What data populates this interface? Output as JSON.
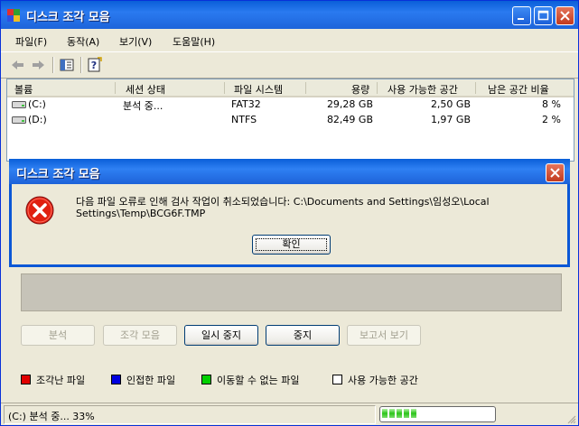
{
  "window": {
    "title": "디스크 조각 모음"
  },
  "menu": [
    {
      "label": "파일(F)"
    },
    {
      "label": "동작(A)"
    },
    {
      "label": "보기(V)"
    },
    {
      "label": "도움말(H)"
    }
  ],
  "toolbar": {
    "icons": [
      "back-arrow-icon",
      "forward-arrow-icon",
      "show-hide-console-tree-icon",
      "help-icon"
    ]
  },
  "volumes": {
    "columns": [
      "볼륨",
      "세션 상태",
      "파일 시스템",
      "용량",
      "사용 가능한 공간",
      "남은 공간 비율"
    ],
    "rows": [
      {
        "volume": "(C:)",
        "status": "분석 중...",
        "fs": "FAT32",
        "capacity": "29,28 GB",
        "free": "2,50 GB",
        "pct": "8 %"
      },
      {
        "volume": "(D:)",
        "status": "",
        "fs": "NTFS",
        "capacity": "82,49 GB",
        "free": "1,97 GB",
        "pct": "2 %"
      }
    ]
  },
  "buttons": {
    "analyze": "분석",
    "defragment": "조각 모음",
    "pause": "일시 중지",
    "stop": "중지",
    "view_report": "보고서 보기"
  },
  "legend": [
    {
      "label": "조각난 파일",
      "color": "#e00000"
    },
    {
      "label": "인접한 파일",
      "color": "#0000e0"
    },
    {
      "label": "이동할 수 없는 파일",
      "color": "#00d000"
    },
    {
      "label": "사용 가능한 공간",
      "color": "#ffffff"
    }
  ],
  "status": {
    "text": "(C:) 분석 중... 33%",
    "progress_percent": 33
  },
  "dialog": {
    "title": "디스크 조각 모음",
    "message": "다음 파일 오류로 인해 검사 작업이 취소되었습니다: C:\\Documents and Settings\\임성오\\Local Settings\\Temp\\BCG6F.TMP",
    "ok_label": "확인"
  },
  "colors": {
    "titlebar": "#0a5fd8",
    "face": "#ece9d8",
    "progress_fill": "#2bc41a"
  }
}
